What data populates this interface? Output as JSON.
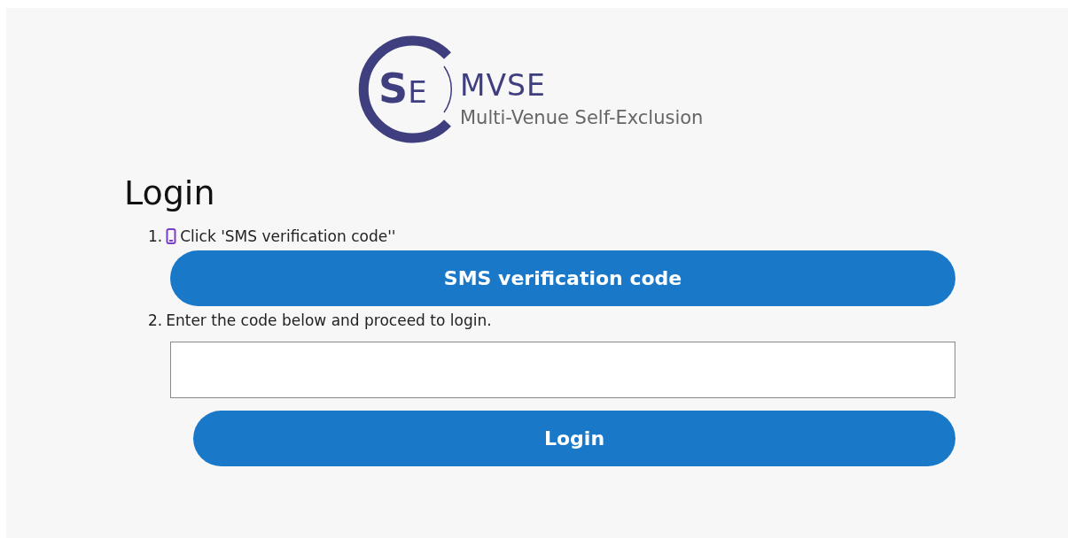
{
  "logo": {
    "letters": [
      "S",
      "E"
    ],
    "name": "MVSE",
    "tagline": "Multi-Venue Self-Exclusion"
  },
  "title": "Login",
  "steps": [
    {
      "number": "1.",
      "text": "Click 'SMS verification code''",
      "icon": true
    },
    {
      "number": "2.",
      "text": "Enter the code below and proceed to login.",
      "icon": false
    }
  ],
  "sms_button": "SMS verification code",
  "login_button": "Login"
}
